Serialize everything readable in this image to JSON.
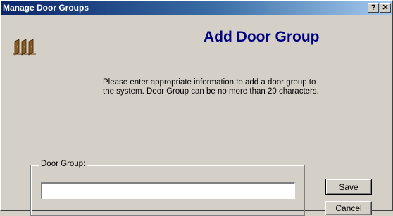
{
  "window": {
    "title": "Manage Door Groups",
    "help_label": "?",
    "close_label": "✕"
  },
  "dialog": {
    "heading": "Add Door Group",
    "instructions": "Please enter appropriate information to add a door group to the system. Door Group can be no more than 20 characters.",
    "icon": "doors-icon"
  },
  "form": {
    "door_group_label": "Door Group:",
    "door_group_value": ""
  },
  "buttons": {
    "save_label": "Save",
    "cancel_label": "Cancel"
  },
  "colors": {
    "titlebar_start": "#0a246a",
    "titlebar_end": "#a6caf0",
    "heading": "#000080",
    "window_bg": "#d4d0c8"
  }
}
